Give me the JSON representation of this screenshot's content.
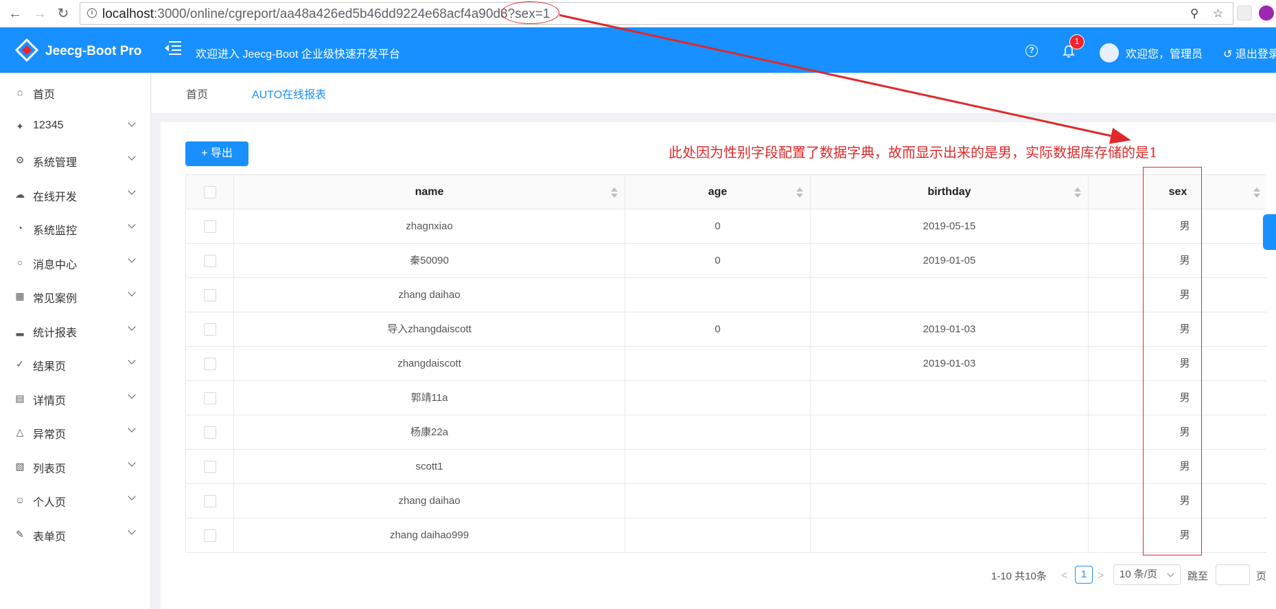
{
  "browser": {
    "url_host": "localhost",
    "url_rest": ":3000/online/cgreport/aa48a426ed5b46dd9224e68acf4a90d8?sex=1"
  },
  "header": {
    "brand": "Jeecg-Boot Pro",
    "title": "欢迎进入 Jeecg-Boot 企业级快速开发平台",
    "notification_count": "1",
    "user_greeting": "欢迎您，管理员",
    "logout": "退出登录"
  },
  "sidebar": {
    "items": [
      {
        "label": "首页",
        "icon": "home-icon",
        "expandable": false
      },
      {
        "label": "12345",
        "icon": "gitlab-icon",
        "expandable": true
      },
      {
        "label": "系统管理",
        "icon": "gear-icon",
        "expandable": true
      },
      {
        "label": "在线开发",
        "icon": "cloud-icon",
        "expandable": true
      },
      {
        "label": "系统监控",
        "icon": "dashboard-icon",
        "expandable": true
      },
      {
        "label": "消息中心",
        "icon": "message-icon",
        "expandable": true
      },
      {
        "label": "常见案例",
        "icon": "qrcode-icon",
        "expandable": true
      },
      {
        "label": "统计报表",
        "icon": "chart-icon",
        "expandable": true
      },
      {
        "label": "结果页",
        "icon": "check-circle-icon",
        "expandable": true
      },
      {
        "label": "详情页",
        "icon": "profile-icon",
        "expandable": true
      },
      {
        "label": "异常页",
        "icon": "warning-icon",
        "expandable": true
      },
      {
        "label": "列表页",
        "icon": "table-icon",
        "expandable": true
      },
      {
        "label": "个人页",
        "icon": "user-icon",
        "expandable": true
      },
      {
        "label": "表单页",
        "icon": "form-icon",
        "expandable": true
      }
    ]
  },
  "tabs": [
    {
      "label": "首页",
      "active": false
    },
    {
      "label": "AUTO在线报表",
      "active": true
    }
  ],
  "toolbar": {
    "export_label": "导出",
    "export_icon": "plus-icon"
  },
  "annotation": {
    "text": "此处因为性别字段配置了数据字典，故而显示出来的是男，实际数据库存储的是1"
  },
  "table": {
    "columns": [
      "name",
      "age",
      "birthday",
      "sex"
    ],
    "rows": [
      {
        "name": "zhagnxiao",
        "age": "0",
        "birthday": "2019-05-15",
        "sex": "男"
      },
      {
        "name": "秦50090",
        "age": "0",
        "birthday": "2019-01-05",
        "sex": "男"
      },
      {
        "name": "zhang daihao",
        "age": "",
        "birthday": "",
        "sex": "男"
      },
      {
        "name": "导入zhangdaiscott",
        "age": "0",
        "birthday": "2019-01-03",
        "sex": "男"
      },
      {
        "name": "zhangdaiscott",
        "age": "",
        "birthday": "2019-01-03",
        "sex": "男"
      },
      {
        "name": "郭靖11a",
        "age": "",
        "birthday": "",
        "sex": "男"
      },
      {
        "name": "杨康22a",
        "age": "",
        "birthday": "",
        "sex": "男"
      },
      {
        "name": "scott1",
        "age": "",
        "birthday": "",
        "sex": "男"
      },
      {
        "name": "zhang daihao",
        "age": "",
        "birthday": "",
        "sex": "男"
      },
      {
        "name": "zhang daihao999",
        "age": "",
        "birthday": "",
        "sex": "男"
      }
    ]
  },
  "pagination": {
    "total_text": "1-10 共10条",
    "prev": "<",
    "current_page": "1",
    "next": ">",
    "page_size": "10 条/页",
    "jump_label": "跳至",
    "jump_value": "",
    "jump_unit": "页"
  },
  "colors": {
    "primary": "#1890ff",
    "annotation_red": "#e0282a"
  }
}
